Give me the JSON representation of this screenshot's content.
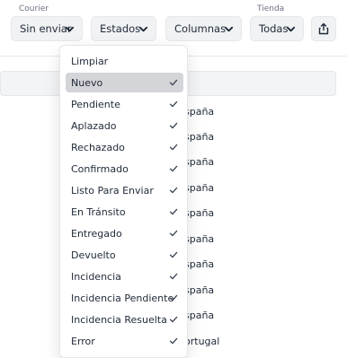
{
  "toolbar": {
    "courier": {
      "label": "Courier",
      "value": "Sin enviar"
    },
    "estados": {
      "value": "Estados"
    },
    "columnas": {
      "value": "Columnas"
    },
    "tienda": {
      "label": "Tienda",
      "value": "Todas"
    },
    "export_icon": "share-upload-icon"
  },
  "table": {
    "country_cells": [
      "spaña",
      "spaña",
      "spaña",
      "spaña",
      "spaña",
      "spaña",
      "spaña",
      "spaña",
      "spaña",
      "ortugal"
    ]
  },
  "dropdown": {
    "clear_label": "Limpiar",
    "items": [
      {
        "label": "Nuevo",
        "checked": true,
        "highlighted": true
      },
      {
        "label": "Pendiente",
        "checked": true
      },
      {
        "label": "Aplazado",
        "checked": true
      },
      {
        "label": "Rechazado",
        "checked": true
      },
      {
        "label": "Confirmado",
        "checked": true
      },
      {
        "label": "Listo Para Enviar",
        "checked": true
      },
      {
        "label": "En Tránsito",
        "checked": true
      },
      {
        "label": "Entregado",
        "checked": true
      },
      {
        "label": "Devuelto",
        "checked": true
      },
      {
        "label": "Incidencia",
        "checked": true
      },
      {
        "label": "Incidencia Pendiente",
        "checked": true
      },
      {
        "label": "Incidencia Resuelta",
        "checked": true
      },
      {
        "label": "Error",
        "checked": true
      }
    ],
    "highlight_color": "#d4d5d9"
  }
}
